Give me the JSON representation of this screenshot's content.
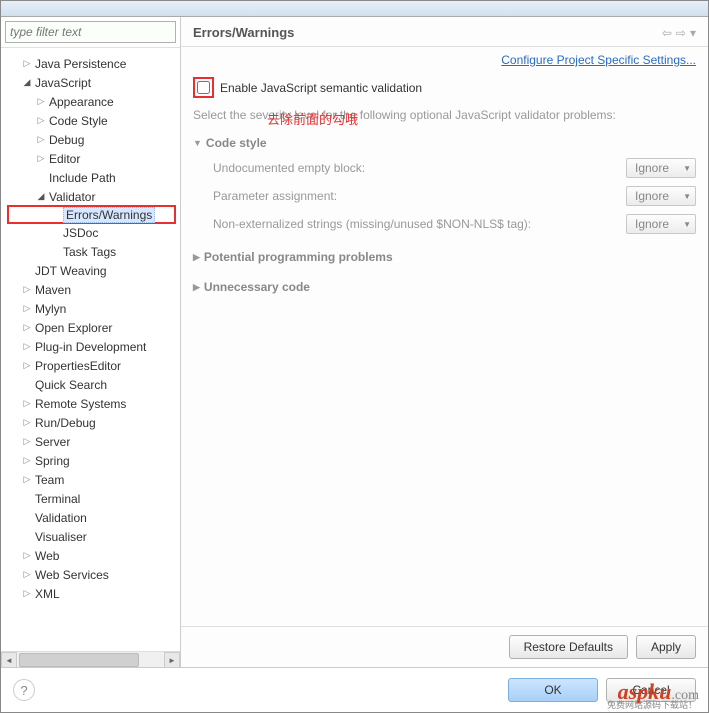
{
  "filter_placeholder": "type filter text",
  "tree": [
    {
      "label": "Java Persistence",
      "indent": 1,
      "arrow": "right"
    },
    {
      "label": "JavaScript",
      "indent": 1,
      "arrow": "down"
    },
    {
      "label": "Appearance",
      "indent": 2,
      "arrow": "right"
    },
    {
      "label": "Code Style",
      "indent": 2,
      "arrow": "right"
    },
    {
      "label": "Debug",
      "indent": 2,
      "arrow": "right"
    },
    {
      "label": "Editor",
      "indent": 2,
      "arrow": "right"
    },
    {
      "label": "Include Path",
      "indent": 2,
      "arrow": ""
    },
    {
      "label": "Validator",
      "indent": 2,
      "arrow": "down"
    },
    {
      "label": "Errors/Warnings",
      "indent": 3,
      "arrow": "",
      "selected": true,
      "boxed": true
    },
    {
      "label": "JSDoc",
      "indent": 3,
      "arrow": ""
    },
    {
      "label": "Task Tags",
      "indent": 3,
      "arrow": ""
    },
    {
      "label": "JDT Weaving",
      "indent": 1,
      "arrow": ""
    },
    {
      "label": "Maven",
      "indent": 1,
      "arrow": "right"
    },
    {
      "label": "Mylyn",
      "indent": 1,
      "arrow": "right"
    },
    {
      "label": "Open Explorer",
      "indent": 1,
      "arrow": "right"
    },
    {
      "label": "Plug-in Development",
      "indent": 1,
      "arrow": "right"
    },
    {
      "label": "PropertiesEditor",
      "indent": 1,
      "arrow": "right"
    },
    {
      "label": "Quick Search",
      "indent": 1,
      "arrow": ""
    },
    {
      "label": "Remote Systems",
      "indent": 1,
      "arrow": "right"
    },
    {
      "label": "Run/Debug",
      "indent": 1,
      "arrow": "right"
    },
    {
      "label": "Server",
      "indent": 1,
      "arrow": "right"
    },
    {
      "label": "Spring",
      "indent": 1,
      "arrow": "right"
    },
    {
      "label": "Team",
      "indent": 1,
      "arrow": "right"
    },
    {
      "label": "Terminal",
      "indent": 1,
      "arrow": ""
    },
    {
      "label": "Validation",
      "indent": 1,
      "arrow": ""
    },
    {
      "label": "Visualiser",
      "indent": 1,
      "arrow": ""
    },
    {
      "label": "Web",
      "indent": 1,
      "arrow": "right"
    },
    {
      "label": "Web Services",
      "indent": 1,
      "arrow": "right"
    },
    {
      "label": "XML",
      "indent": 1,
      "arrow": "right"
    }
  ],
  "main": {
    "title": "Errors/Warnings",
    "config_link": "Configure Project Specific Settings...",
    "checkbox_label": "Enable JavaScript semantic validation",
    "annotation": "去除前面的勾哦",
    "desc": "Select the severity level for the following optional JavaScript validator problems:",
    "sections": {
      "code_style": {
        "title": "Code style",
        "options": [
          {
            "label": "Undocumented empty block:",
            "value": "Ignore"
          },
          {
            "label": "Parameter assignment:",
            "value": "Ignore"
          },
          {
            "label": "Non-externalized strings (missing/unused $NON-NLS$ tag):",
            "value": "Ignore"
          }
        ]
      },
      "potential": "Potential programming problems",
      "unnecessary": "Unnecessary code"
    },
    "restore_defaults": "Restore Defaults",
    "apply": "Apply"
  },
  "dialog": {
    "ok": "OK",
    "cancel": "Cancel"
  },
  "watermark": "aspku",
  "watermark_suffix": ".com",
  "watermark_sub": "免费网站源码下载站！"
}
